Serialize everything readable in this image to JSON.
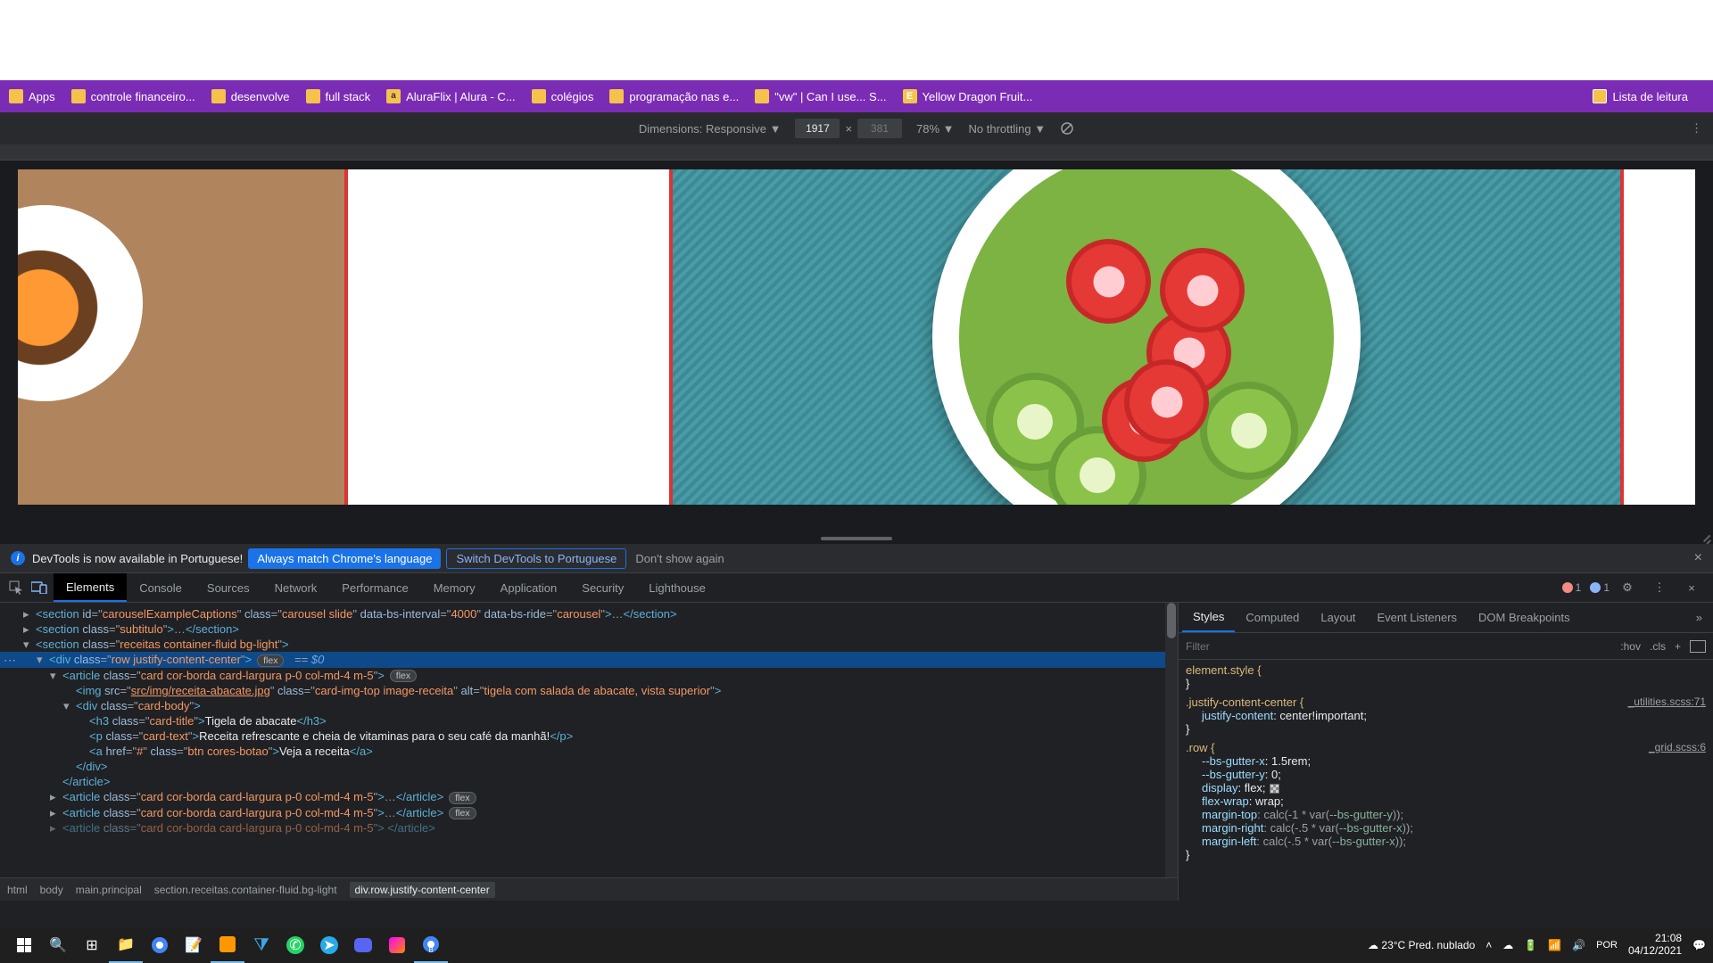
{
  "bookmarks": {
    "apps": "Apps",
    "b1": "controle financeiro...",
    "b2": "desenvolve",
    "b3": "full stack",
    "b4": "AluraFlix | Alura - C...",
    "b5": "colégios",
    "b6": "programação nas e...",
    "b7": "\"vw\" | Can I use... S...",
    "b8": "Yellow Dragon Fruit...",
    "reading": "Lista de leitura"
  },
  "device_toolbar": {
    "dimensions_label": "Dimensions: Responsive ▼",
    "width": "1917",
    "x": "×",
    "height": "381",
    "zoom": "78% ▼",
    "throttling": "No throttling ▼"
  },
  "info_bar": {
    "msg": "DevTools is now available in Portuguese!",
    "btn1": "Always match Chrome's language",
    "btn2": "Switch DevTools to Portuguese",
    "dismiss": "Don't show again"
  },
  "devtools_tabs": {
    "elements": "Elements",
    "console": "Console",
    "sources": "Sources",
    "network": "Network",
    "performance": "Performance",
    "memory": "Memory",
    "application": "Application",
    "security": "Security",
    "lighthouse": "Lighthouse",
    "err_count": "1",
    "msg_count": "1"
  },
  "dom": {
    "l1_pre": "<section id=\"",
    "l1_id": "carouselExampleCaptions",
    "l1_mid1": "\" class=\"",
    "l1_cls": "carousel slide",
    "l1_mid2": "\" data-bs-interval=\"",
    "l1_int": "4000",
    "l1_mid3": "\" data-bs-ride=\"",
    "l1_ride": "carousel",
    "l1_end": "\">…</section>",
    "l2": "<section class=\"subtitulo\">…</section>",
    "l3": "<section class=\"receitas container-fluid bg-light\">",
    "l4": "<div class=\"row justify-content-center\">",
    "l4_pill": "flex",
    "l4_eq": " == $0",
    "l5": "<article class=\"card cor-borda card-largura p-0 col-md-4 m-5\">",
    "l5_pill": "flex",
    "l6_pre": "<img src=\"",
    "l6_src": "src/img/receita-abacate.jpg",
    "l6_mid1": "\" class=\"",
    "l6_cls": "card-img-top image-receita",
    "l6_mid2": "\" alt=\"",
    "l6_alt": "tigela com salada de abacate, vista superior",
    "l6_end": "\">",
    "l7": "<div class=\"card-body\">",
    "l8_open": "<h3 class=\"card-title\">",
    "l8_txt": "Tigela de abacate",
    "l8_close": "</h3>",
    "l9_open": "<p class=\"card-text\">",
    "l9_txt": "Receita refrescante e cheia de vitaminas para o seu café da manhã!",
    "l9_close": "</p>",
    "l10_open": "<a href=\"#\" class=\"btn cores-botao\">",
    "l10_txt": "Veja a receita",
    "l10_close": "</a>",
    "l11": "</div>",
    "l12": "</article>",
    "l13": "<article class=\"card cor-borda card-largura p-0 col-md-4 m-5\">…</article>",
    "l13_pill": "flex",
    "l14": "<article class=\"card cor-borda card-largura p-0 col-md-4 m-5\">…</article>",
    "l14_pill": "flex",
    "l15": "<article class=\"card cor-borda card-largura p-0 col-md-4 m-5\">…</article>"
  },
  "breadcrumb": {
    "c1": "html",
    "c2": "body",
    "c3": "main.principal",
    "c4": "section.receitas.container-fluid.bg-light",
    "c5": "div.row.justify-content-center"
  },
  "styles": {
    "tabs": {
      "styles": "Styles",
      "computed": "Computed",
      "layout": "Layout",
      "listeners": "Event Listeners",
      "dom_bp": "DOM Breakpoints"
    },
    "filter_placeholder": "Filter",
    "hov": ":hov",
    "cls": ".cls",
    "r1_sel": "element.style {",
    "r1_close": "}",
    "r2_sel": ".justify-content-center {",
    "r2_src": "_utilities.scss:71",
    "r2_p1n": "justify-content",
    "r2_p1v": ": center!important;",
    "r2_close": "}",
    "r3_sel": ".row {",
    "r3_src": "_grid.scss:6",
    "p_gx_n": "--bs-gutter-x",
    "p_gx_v": ": 1.5rem;",
    "p_gy_n": "--bs-gutter-y",
    "p_gy_v": ": 0;",
    "p_disp_n": "display",
    "p_disp_v": ": flex;",
    "p_fw_n": "flex-wrap",
    "p_fw_v": ": wrap;",
    "p_mt_n": "margin-top",
    "p_mt_v": ": calc(-1 * var(",
    "p_mt_var": "--bs-gutter-y",
    "p_mt_end": "));",
    "p_mr_n": "margin-right",
    "p_mr_v": ": calc(-.5 * var(",
    "p_mr_var": "--bs-gutter-x",
    "p_mr_end": "));",
    "p_ml_n": "margin-left",
    "p_ml_v": ": calc(-.5 * var(",
    "p_ml_var": "--bs-gutter-x",
    "p_ml_end": "));",
    "r3_close": "}"
  },
  "taskbar": {
    "weather": "23°C  Pred. nublado",
    "time": "21:08",
    "date": "04/12/2021"
  }
}
